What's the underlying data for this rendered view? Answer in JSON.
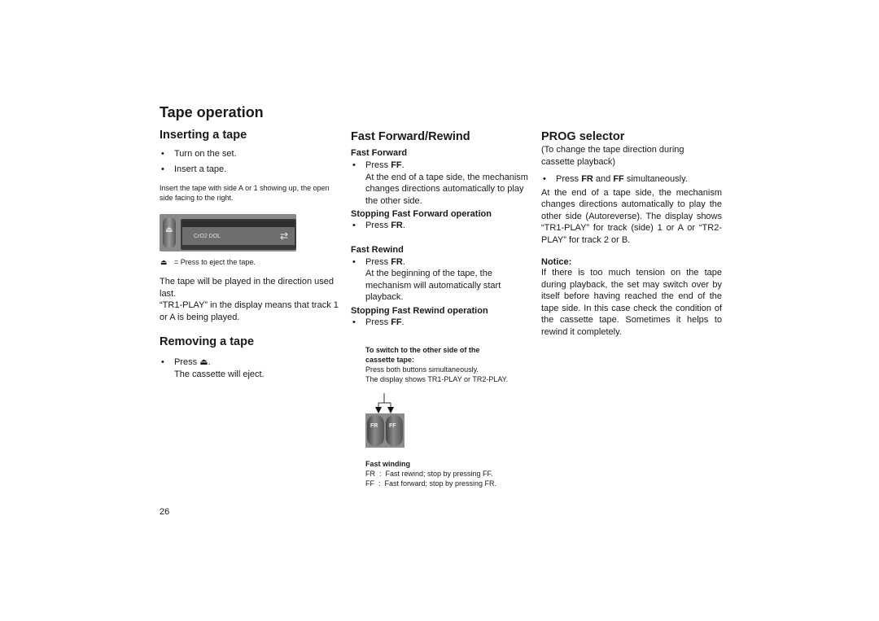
{
  "page_title": "Tape operation",
  "page_number": "26",
  "left": {
    "inserting": {
      "heading": "Inserting a tape",
      "bullets": [
        "Turn on the set.",
        "Insert a tape."
      ],
      "caption": "Insert the tape with side A or 1 showing up, the open side facing to the right.",
      "deck_image": {
        "label": "CrO2 DOL",
        "icon": "eject-button",
        "arrow": "tape-direction-arrow"
      },
      "eject_legend_symbol": "⏏",
      "eject_legend_text": "= Press to eject the tape.",
      "para1": "The tape will be played in the direction used last.",
      "para2": "“TR1-PLAY” in the display means that track 1 or A is being played."
    },
    "removing": {
      "heading": "Removing a tape",
      "bullet_prefix": "Press ",
      "bullet_symbol": "⏏",
      "bullet_suffix": ".",
      "bullet_line2": "The cassette will eject."
    }
  },
  "middle": {
    "heading": "Fast Forward/Rewind",
    "ff": {
      "heading": "Fast Forward",
      "press_prefix": "Press ",
      "press_key": "FF",
      "desc": "At the end of a tape side, the mechanism changes directions automatically to play the other side."
    },
    "stop_ff": {
      "heading": "Stopping Fast Forward operation",
      "press_prefix": "Press ",
      "press_key": "FR"
    },
    "fr": {
      "heading": "Fast Rewind",
      "press_prefix": "Press ",
      "press_key": "FR",
      "desc": "At the beginning of the tape, the mechanism will automatically start playback."
    },
    "stop_fr": {
      "heading": "Stopping Fast Rewind operation",
      "press_prefix": "Press ",
      "press_key": "FF"
    },
    "switch": {
      "heading": "To switch to the other side of the cassette tape:",
      "line1": "Press both buttons simultaneously.",
      "line2": "The display shows TR1-PLAY or TR2-PLAY."
    },
    "buttons_image": {
      "left": "FR",
      "right": "FF"
    },
    "winding": {
      "heading": "Fast winding",
      "lines": [
        "FR  :  Fast rewind; stop by pressing FF.",
        "FF  :  Fast forward; stop by pressing FR."
      ]
    }
  },
  "right": {
    "heading": "PROG selector",
    "intro": "(To change the tape direction during cassette playback)",
    "bullet_pre": "Press ",
    "bullet_k1": "FR",
    "bullet_mid": " and ",
    "bullet_k2": "FF",
    "bullet_post": " simultaneously.",
    "para": "At the end of a tape side, the mechanism changes directions automatically to play the other side (Autoreverse). The display shows “TR1-PLAY” for track (side) 1 or A or “TR2-PLAY” for track 2 or B.",
    "notice_heading": "Notice:",
    "notice_text": "If there is too much tension on the tape during playback, the set may switch over by itself before having reached the end of the tape side. In this case check the condition of the cassette tape. Sometimes it helps to rewind it completely."
  }
}
